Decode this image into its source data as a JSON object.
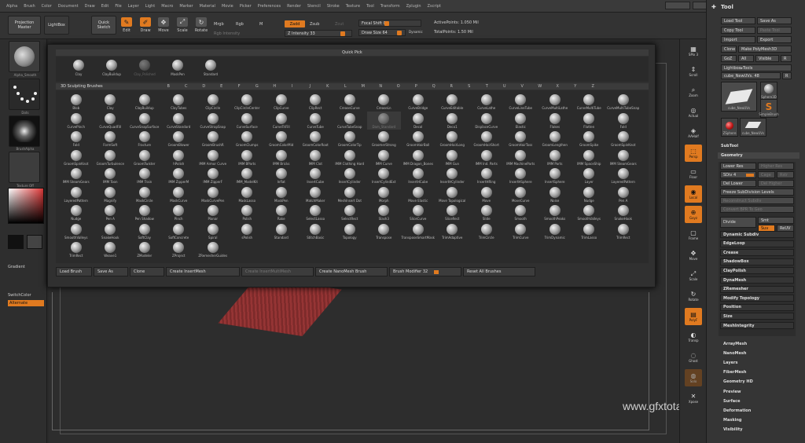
{
  "menu": {
    "items": [
      "Alpha",
      "Brush",
      "Color",
      "Document",
      "Draw",
      "Edit",
      "File",
      "Layer",
      "Light",
      "Macro",
      "Marker",
      "Material",
      "Movie",
      "Picker",
      "Preferences",
      "Render",
      "Stencil",
      "Stroke",
      "Texture",
      "Tool",
      "Transform",
      "Zplugin",
      "Zscript"
    ],
    "right_buttons": [
      "",
      "",
      "",
      "",
      ""
    ]
  },
  "shelf": {
    "projection_master": "Projection Master",
    "lightbox": "LightBox",
    "quick_sketch": "Quick Sketch",
    "edit": "Edit",
    "draw": "Draw",
    "move": "Move",
    "scale": "Scale",
    "rotate": "Rotate",
    "mrgb": "Mrgb",
    "rgb": "Rgb",
    "m": "M",
    "zadd": "Zadd",
    "zsub": "Zsub",
    "zcut": "Zcut",
    "rgb_intensity": "Rgb Intensity",
    "z_intensity": "Z Intensity 33",
    "focal_shift": "Focal Shift 0",
    "draw_size": "Draw Size 64",
    "dynamic": "Dynamic",
    "active_points": "ActivePoints: 1.050 Mil",
    "total_points": "TotalPoints: 1.50 Mil"
  },
  "left_tray": {
    "alpha_label": "Alpha_Smooth",
    "stroke_label": "Dots",
    "brush_alpha_label": "BrushAlpha",
    "texture_label": "Texture Off",
    "material_label": "SkinShade4",
    "gradient": "Gradient",
    "switch_color": "SwitchColor",
    "alternate": "Alternate"
  },
  "quick_pick": {
    "title": "Quick Pick",
    "items": [
      {
        "label": "Clay",
        "faded": false
      },
      {
        "label": "ClayBuildup",
        "faded": false
      },
      {
        "label": "Clay_Polished",
        "faded": true
      },
      {
        "label": "MaskPen",
        "faded": false
      },
      {
        "label": "Standard",
        "faded": false
      }
    ]
  },
  "brush_palette": {
    "title": "3D Sculpting Brushes",
    "letters": [
      "B",
      "C",
      "D",
      "E",
      "F",
      "G",
      "H",
      "I",
      "J",
      "K",
      "L",
      "M",
      "N",
      "O",
      "P",
      "Q",
      "R",
      "S",
      "T",
      "U",
      "V",
      "W",
      "X",
      "Y",
      "Z"
    ],
    "brushes": [
      "Blob",
      "Clay",
      "ClayBuildup",
      "ClayTubes",
      "ClipCircle",
      "ClipCircleCenter",
      "ClipCurve",
      "ClipRect",
      "CreaseCurve",
      "CreaseLn",
      "CurveBridge",
      "CurveEditable",
      "CurveLathe",
      "CurveLineTube",
      "CurveMultiLathe",
      "CurveMultiTube",
      "CurveMultiTubeSnap",
      "CurvePinch",
      "CurveQuadFill",
      "CurveSnapSurface",
      "CurveStandard",
      "CurveStrapSnap",
      "CurveSurface",
      "CurveTriFill",
      "CurveTube",
      "CurveTubeSnap",
      "Dam_Standard",
      "Decol",
      "Deco1",
      "DisplaceCurve",
      "Elastic",
      "Flakes",
      "Flatten",
      "Fold",
      "Fold",
      "FormSoft",
      "Fracture",
      "GroomBlower",
      "GroomBrushR",
      "GroomClumps",
      "GroomColorMid",
      "GroomColorRoot",
      "GroomColorTip",
      "GroomerStrong",
      "GroomHairBall",
      "GroomHairLong",
      "GroomHairShort",
      "GroomHairToss",
      "GroomLengthen",
      "GroomSpike",
      "GroomSpinKnot",
      "GroomSpinKnot",
      "GroomTurbulence",
      "GroomTwister",
      "hPolish",
      "IMM Armor Curve",
      "IMM BParts",
      "IMM Bricks",
      "IMM Clot",
      "IMM Clothing Hard",
      "IMM Curve",
      "IMM Dragon_Bones",
      "IMM Gun",
      "IMM Ind. Parts",
      "IMM MachineParts",
      "IMM Parts",
      "IMM SpaceShip",
      "IMM SteamGears",
      "IMM SteamGears",
      "IMM Toon",
      "IMM Train",
      "IMM ZipperM",
      "IMM ZipperF",
      "IMM_ModelKit",
      "Inflat",
      "InsertCube",
      "InsertCylinder",
      "InsertCylindExt",
      "InsertHCube",
      "InsertHCylinder",
      "InsertHRing",
      "InsertHSphere",
      "InsertSphere",
      "Layer",
      "LayeredPattern",
      "LayeredPattern",
      "Magnify",
      "MaskCircle",
      "MaskCurve",
      "MaskCurvePen",
      "MaskLasso",
      "MaskPen",
      "MatchMaker",
      "MeshInsert Dot",
      "Morph",
      "Move Elastic",
      "Move Topological",
      "Move",
      "MoveCurve",
      "Noise",
      "Nudge",
      "Pen A",
      "Nudge",
      "Pen A",
      "Pen Shadow",
      "Pinch",
      "Planar",
      "Polish",
      "Rake",
      "SelectLasso",
      "SelectRect",
      "Slash3",
      "SliceCurve",
      "SliceRect",
      "Slide",
      "Smooth",
      "SmoothPeaks",
      "SmoothValleys",
      "SnakeHook",
      "SmoothValleys",
      "SnakeHook",
      "SoftClay",
      "SoftConcrete",
      "Spiral",
      "sPolish",
      "Standard",
      "StitchBasic",
      "Topology",
      "Transpose",
      "TransposeSmartMask",
      "TrimAdaptive",
      "TrimCircle",
      "TrimCurve",
      "TrimDynamic",
      "TrimLasso",
      "TrimRect",
      "TrimRect",
      "Weave1",
      "ZModeler",
      "ZProject",
      "ZRemesherGuides"
    ]
  },
  "bottom_bar": {
    "load_brush": "Load Brush",
    "save_as": "Save As",
    "clone": "Clone",
    "create_insertmesh": "Create InsertMesh",
    "create_insertmultimesh": "Create InsertMultiMesh",
    "create_nanomesh": "Create NanoMesh Brush",
    "brush_modifier": "Brush Modifier 32",
    "reset_all": "Reset All Brushes"
  },
  "right_shelf": [
    "SPix 3",
    "Scroll",
    "Zoom",
    "Actual",
    "AAHalf",
    "Persp",
    "Floor",
    "Local",
    "Gxyz",
    "Frame",
    "Move",
    "Scale",
    "Rotate",
    "PolyF",
    "Transp",
    "Ghost",
    "Solo",
    "Xpose"
  ],
  "tool_panel": {
    "title": "Tool",
    "load_tool": "Load Tool",
    "save_as": "Save As",
    "copy_tool": "Copy Tool",
    "paste_tool": "Paste Tool",
    "import": "Import",
    "export": "Export",
    "clone": "Clone",
    "make_polymesh": "Make PolyMesh3D",
    "goz": "GoZ",
    "all": "All",
    "visible": "Visible",
    "r": "R",
    "lightbox_tools": "Lightbox▸Tools",
    "current_tool": "cube_NewUVs. 48",
    "thumbs": [
      {
        "label": "cube_NewUVs"
      },
      {
        "label": "Sphere3D"
      },
      {
        "label": "SimpleBrush"
      },
      {
        "label": "ZSphere"
      },
      {
        "label": "cube_NewUVs"
      }
    ],
    "subtool": "SubTool",
    "geometry": "Geometry",
    "lower_res": "Lower Res",
    "higher_res": "Higher Res",
    "sdiv": "SDiv 4",
    "cage": "Cage",
    "rstr": "Rstr",
    "del_lower": "Del Lower",
    "del_higher": "Del Higher",
    "freeze_subdiv": "Freeze SubDivision Levels",
    "reconstruct": "Reconstruct Subdiv",
    "convert_bpr": "Convert BPR To Geo",
    "divide": "Divide",
    "smt": "Smt",
    "suv": "Suv",
    "reuv": "ReUV",
    "geometry_items": [
      "Dynamic Subdiv",
      "EdgeLoop",
      "Crease",
      "ShadowBox",
      "ClayPolish",
      "DynaMesh",
      "ZRemesher",
      "Modify Topology",
      "Position",
      "Size",
      "MeshIntegrity"
    ],
    "sections": [
      "ArrayMesh",
      "NanoMesh",
      "Layers",
      "FiberMesh",
      "Geometry HD",
      "Preview",
      "Surface",
      "Deformation",
      "Masking",
      "Visibility"
    ]
  },
  "watermark": "www.gfxtotal.com.br",
  "colors": {
    "accent": "#e07a20",
    "panel": "#303030",
    "background": "#2a2a2a"
  }
}
